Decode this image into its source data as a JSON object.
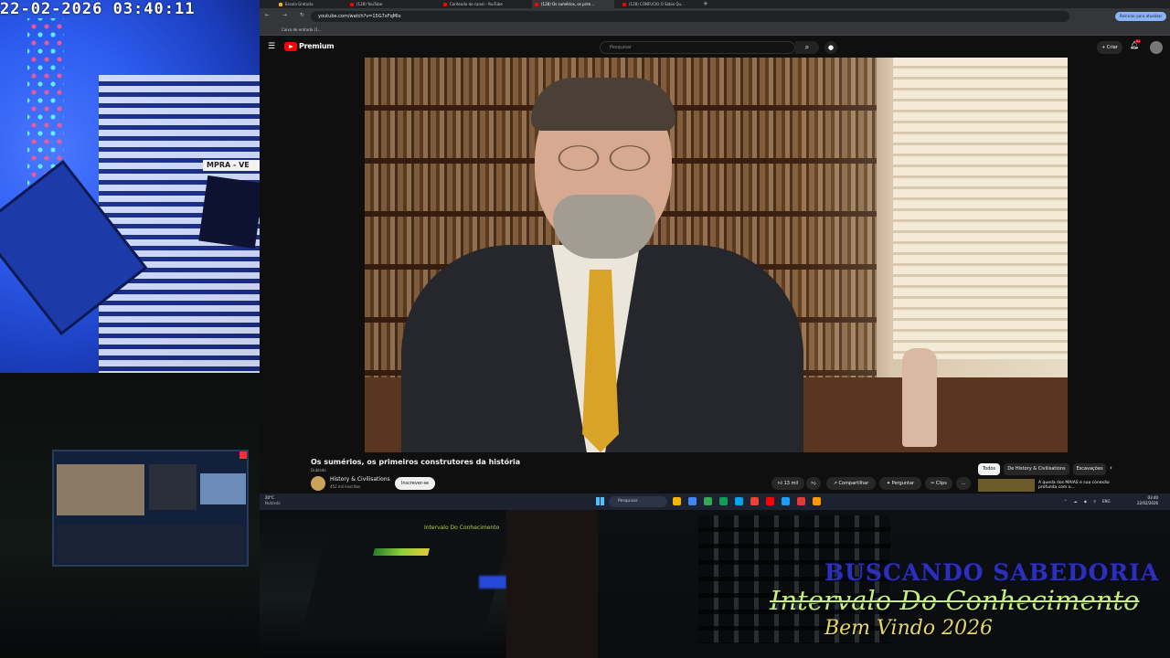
{
  "webcam": {
    "timestamp": "22-02-2026  03:40:11",
    "sign_text": "MPRA - VE"
  },
  "browser": {
    "tabs": [
      {
        "label": "Escola Gratuita",
        "favicon_color": "#f4b400",
        "active": false
      },
      {
        "label": "(128) YouTube",
        "favicon_color": "#ff0000",
        "active": false
      },
      {
        "label": "Conteúdo do canal - YouTube",
        "favicon_color": "#ff0000",
        "active": false
      },
      {
        "label": "(128) Os sumérios, os prim...",
        "favicon_color": "#ff0000",
        "active": true
      },
      {
        "label": "(128) CONFUCIO O Sábio Qu...",
        "favicon_color": "#ff0000",
        "active": false
      }
    ],
    "new_tab": "+",
    "url": "youtube.com/watch?v=15G7xFqMlo",
    "relaunch_label": "Reiniciar para atualizar",
    "bookmark": "Caixa de entrada (1..."
  },
  "youtube": {
    "logo_text": "Premium",
    "search_placeholder": "Pesquisar",
    "create_label": "+ Criar",
    "notification_count": "9+",
    "video": {
      "title": "Os sumérios, os primeiros construtores da história",
      "dub_label": "Dublado",
      "channel_name": "History & Civilisations",
      "subscribers": "452 mil inscritos",
      "subscribe_label": "Inscrever-se",
      "likes": "13 mil",
      "share_label": "Compartilhar",
      "ask_label": "Perguntar",
      "clips_label": "Clips",
      "more_label": "..."
    },
    "chips": [
      {
        "label": "Todos",
        "active": true
      },
      {
        "label": "De History & Civilisations",
        "active": false
      },
      {
        "label": "Escavações",
        "active": false
      }
    ],
    "recommendation_title": "A queda dos MAIAS e sua conexão profunda com o..."
  },
  "taskbar": {
    "weather_temp": "20°C",
    "weather_desc": "Nublado",
    "search_placeholder": "Pesquisar",
    "apps": [
      "#f4b400",
      "#4285f4",
      "#34a853",
      "#0f9d58",
      "#00a4ef",
      "#ea4335",
      "#ff0000",
      "#18a0fb",
      "#e53935",
      "#ff9800"
    ],
    "language": "ENG",
    "time": "03:40",
    "date": "22/02/2026"
  },
  "studio": {
    "monitor_text": "Intervalo Do Conhecimento"
  },
  "overlay": {
    "line1": "BUSCANDO  SABEDORIA",
    "line2": "Intervalo Do Conhecimento",
    "line3": "Bem Vindo 2026"
  }
}
